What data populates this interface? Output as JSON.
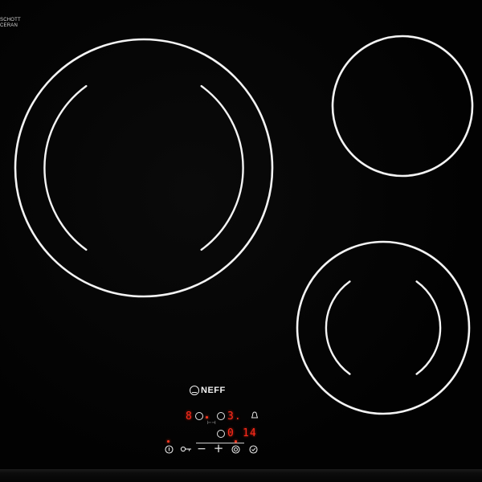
{
  "brand": {
    "logo": "NEFF",
    "glass_marking_line1": "SCHOTT",
    "glass_marking_line2": "CERAN"
  },
  "zones": [
    {
      "name": "large-dual-zone",
      "type": "dual-circuit"
    },
    {
      "name": "small-single-zone",
      "type": "single"
    },
    {
      "name": "medium-dual-zone",
      "type": "dual-circuit"
    }
  ],
  "display": {
    "zone_left_level": "8",
    "zone_right_level": "3.",
    "timer_prefix": "0",
    "timer_value": "14"
  },
  "controls": {
    "power_icon": "power-icon",
    "lock_icon": "child-lock-icon",
    "minus_label": "−",
    "plus_label": "+",
    "zone_select_icon": "zone-select-icon",
    "timer_icon": "timer-icon",
    "alarm_icon": "bell-icon"
  },
  "colors": {
    "glass": "#020202",
    "zone_outline": "#f4f4f4",
    "display_red": "#ff2a1a"
  }
}
